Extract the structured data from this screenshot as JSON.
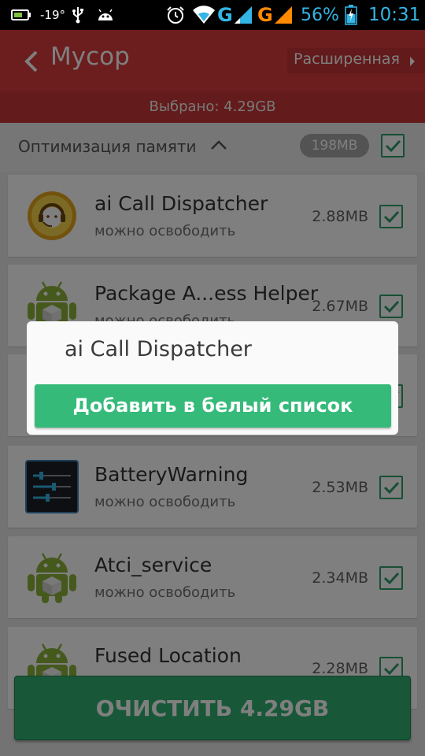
{
  "status_bar": {
    "temperature": "-19°",
    "network_1": "G",
    "network_2": "G",
    "battery": "56%",
    "time": "10:31"
  },
  "toolbar": {
    "title": "Мусор",
    "advanced_label": "Расширенная"
  },
  "selected_text": "Выбрано: 4.29GB",
  "section": {
    "title": "Оптимизация памяти",
    "size": "198MB",
    "checked": true
  },
  "apps": [
    {
      "name": "ai Call Dispatcher",
      "status": "можно освободить",
      "size": "2.88MB",
      "icon": "call-dispatcher-icon",
      "checked": true
    },
    {
      "name": "Package A...ess Helper",
      "status": "можно освободить",
      "size": "2.67MB",
      "icon": "android-icon",
      "checked": true
    },
    {
      "name": "",
      "status": "",
      "size": "",
      "icon": "app-icon",
      "checked": true
    },
    {
      "name": "BatteryWarning",
      "status": "можно освободить",
      "size": "2.53MB",
      "icon": "settings-sliders-icon",
      "checked": true
    },
    {
      "name": "Atci_service",
      "status": "можно освободить",
      "size": "2.34MB",
      "icon": "android-icon",
      "checked": true
    },
    {
      "name": "Fused Location",
      "status": "",
      "size": "2.28MB",
      "icon": "android-icon",
      "checked": true
    }
  ],
  "clean_button": "ОЧИСТИТЬ 4.29GB",
  "dialog": {
    "title": "ai Call Dispatcher",
    "action": "Добавить в белый список"
  },
  "colors": {
    "toolbar_red": "#d93b3b",
    "accent_green": "#30b071",
    "check_green": "#2e9e69",
    "battery_blue": "#33b5e5",
    "signal_orange": "#ff8a00",
    "status_blue": "#33b5e5"
  }
}
